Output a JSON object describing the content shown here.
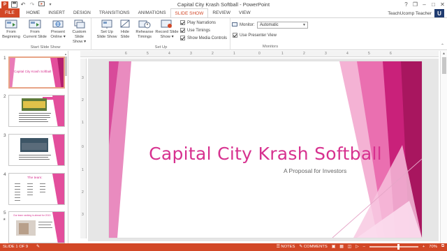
{
  "window": {
    "title": "Capital City Krash Softball - PowerPoint",
    "controls": [
      "?",
      "❐",
      "–",
      "□",
      "✕"
    ]
  },
  "qat": {
    "icons": [
      "save-icon",
      "undo-icon",
      "redo-icon",
      "start-icon",
      "customize-icon"
    ]
  },
  "tabs": [
    {
      "label": "FILE"
    },
    {
      "label": "HOME"
    },
    {
      "label": "INSERT"
    },
    {
      "label": "DESIGN"
    },
    {
      "label": "TRANSITIONS"
    },
    {
      "label": "ANIMATIONS"
    },
    {
      "label": "SLIDE SHOW"
    },
    {
      "label": "REVIEW"
    },
    {
      "label": "VIEW"
    }
  ],
  "active_tab": "SLIDE SHOW",
  "user": {
    "name": "TeachUcomp Teacher",
    "logo": "U"
  },
  "ribbon": {
    "start_group": {
      "label": "Start Slide Show",
      "buttons": [
        {
          "line1": "From",
          "line2": "Beginning"
        },
        {
          "line1": "From",
          "line2": "Current Slide"
        },
        {
          "line1": "Present",
          "line2": "Online ▾"
        },
        {
          "line1": "Custom Slide",
          "line2": "Show ▾"
        }
      ]
    },
    "setup_group": {
      "label": "Set Up",
      "buttons": [
        {
          "line1": "Set Up",
          "line2": "Slide Show"
        },
        {
          "line1": "Hide",
          "line2": "Slide"
        },
        {
          "line1": "Rehearse",
          "line2": "Timings"
        },
        {
          "line1": "Record Slide",
          "line2": "Show ▾"
        }
      ],
      "checks": [
        {
          "label": "Play Narrations",
          "checked": true
        },
        {
          "label": "Use Timings",
          "checked": true
        },
        {
          "label": "Show Media Controls",
          "checked": true
        }
      ]
    },
    "monitors_group": {
      "label": "Monitors",
      "monitor_label": "Monitor:",
      "monitor_value": "Automatic",
      "presenter_view": {
        "label": "Use Presenter View",
        "checked": true
      }
    }
  },
  "thumbnails": [
    {
      "num": "1",
      "title": "Capital City Krash Softball"
    },
    {
      "num": "2"
    },
    {
      "num": "3"
    },
    {
      "num": "4",
      "title": "The team:"
    },
    {
      "num": "5",
      "title": "Our team ranking is ahead for 2013"
    }
  ],
  "slide": {
    "title": "Capital City Krash Softball",
    "subtitle": "A Proposal for Investors"
  },
  "ruler_h": [
    "6",
    "5",
    "4",
    "3",
    "2",
    "1",
    "0",
    "1",
    "2",
    "3",
    "4",
    "5",
    "6"
  ],
  "ruler_v": [
    "3",
    "2",
    "1",
    "0",
    "1",
    "2",
    "3"
  ],
  "status": {
    "slide_info": "SLIDE 1 OF 9",
    "notes": "NOTES",
    "comments": "COMMENTS",
    "zoom": "70%"
  },
  "colors": {
    "accent": "#d24726",
    "title_pink": "#d7318f"
  }
}
